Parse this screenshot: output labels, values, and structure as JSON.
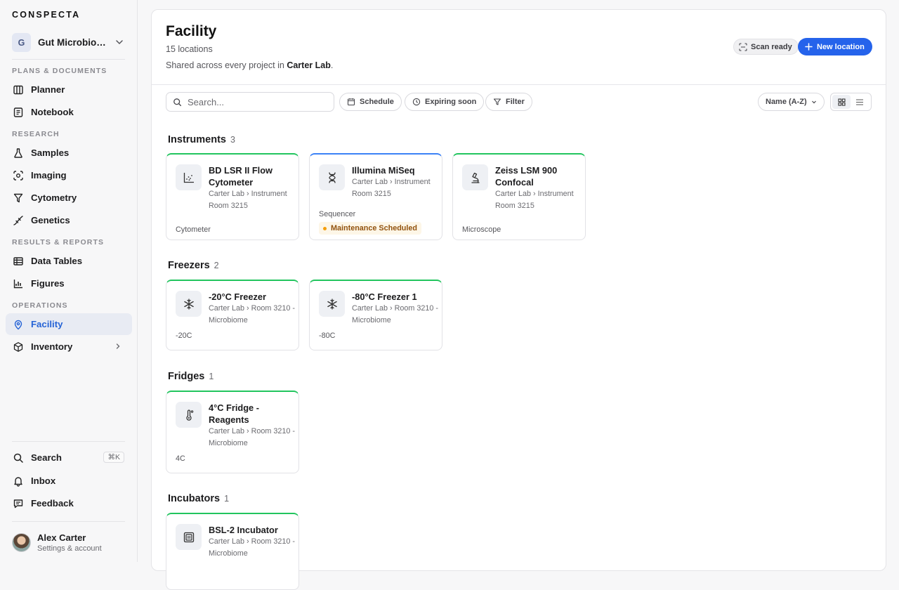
{
  "brand": "CONSPECTA",
  "project": {
    "initial": "G",
    "name": "Gut Microbiome Study"
  },
  "sidebar": {
    "sections": [
      "PLANS & DOCUMENTS",
      "RESEARCH",
      "RESULTS & REPORTS",
      "OPERATIONS"
    ],
    "items": [
      {
        "label": "Planner",
        "icon": "columns-icon"
      },
      {
        "label": "Notebook",
        "icon": "notebook-icon"
      },
      {
        "label": "Samples",
        "icon": "flask-icon"
      },
      {
        "label": "Imaging",
        "icon": "imaging-icon"
      },
      {
        "label": "Cytometry",
        "icon": "funnel-icon"
      },
      {
        "label": "Genetics",
        "icon": "genetics-icon"
      },
      {
        "label": "Data Tables",
        "icon": "table-icon"
      },
      {
        "label": "Figures",
        "icon": "chart-icon"
      },
      {
        "label": "Facility",
        "icon": "location-pin-icon"
      },
      {
        "label": "Inventory",
        "icon": "box-icon"
      }
    ],
    "bottom": [
      {
        "label": "Search",
        "shortcut": "⌘K"
      },
      {
        "label": "Inbox"
      },
      {
        "label": "Feedback"
      }
    ],
    "account": {
      "name": "Alex Carter",
      "sub": "Settings & account"
    }
  },
  "header": {
    "title": "Facility",
    "subtitle": "15 locations",
    "desc_prefix": "Shared across every project in ",
    "desc_lab": "Carter Lab",
    "desc_suffix": ".",
    "scan_label": "Scan ready",
    "new_label": "New location"
  },
  "toolbar": {
    "search_placeholder": "Search...",
    "schedule": "Schedule",
    "expiring": "Expiring soon",
    "filter": "Filter",
    "sort": "Name (A-Z)"
  },
  "groups": [
    {
      "name": "Instruments",
      "count": "3",
      "cards": [
        {
          "title": "BD LSR II Flow Cytometer",
          "location": "Carter Lab › Instrument Room 3215",
          "type": "Cytometer",
          "icon": "scatter-plot-icon"
        },
        {
          "title": "Illumina MiSeq",
          "location": "Carter Lab › Instrument Room 3215",
          "type": "Sequencer",
          "status": "Maintenance Scheduled",
          "icon": "dna-icon"
        },
        {
          "title": "Zeiss LSM 900 Confocal",
          "location": "Carter Lab › Instrument Room 3215",
          "type": "Microscope",
          "icon": "microscope-icon"
        }
      ]
    },
    {
      "name": "Freezers",
      "count": "2",
      "cards": [
        {
          "title": "-20°C Freezer",
          "location": "Carter Lab › Room 3210 - Microbiome",
          "type": "-20C",
          "icon": "snowflake-icon"
        },
        {
          "title": "-80°C Freezer 1",
          "location": "Carter Lab › Room 3210 - Microbiome",
          "type": "-80C",
          "icon": "snowflake-icon"
        }
      ]
    },
    {
      "name": "Fridges",
      "count": "1",
      "cards": [
        {
          "title": "4°C Fridge - Reagents",
          "location": "Carter Lab › Room 3210 - Microbiome",
          "type": "4C",
          "icon": "thermometer-icon"
        }
      ]
    },
    {
      "name": "Incubators",
      "count": "1",
      "cards": [
        {
          "title": "BSL-2 Incubator",
          "location": "Carter Lab › Room 3210 - Microbiome",
          "icon": "incubator-icon"
        }
      ]
    }
  ]
}
